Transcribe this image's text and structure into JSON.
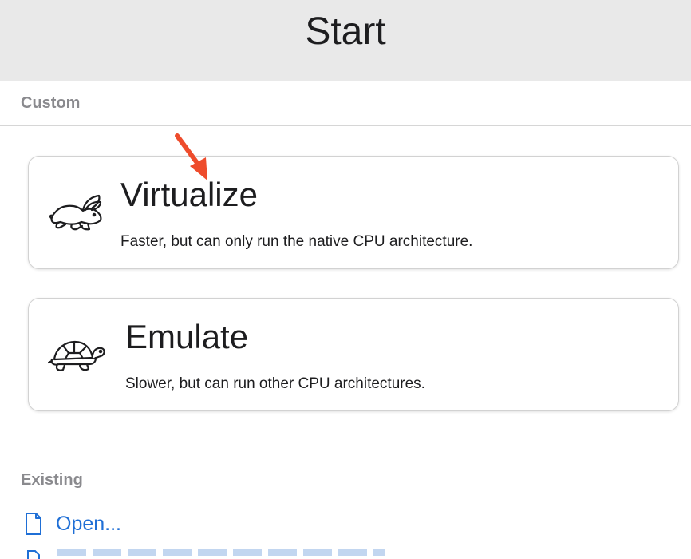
{
  "header": {
    "title": "Start"
  },
  "sections": {
    "custom_label": "Custom",
    "existing_label": "Existing"
  },
  "options": [
    {
      "title": "Virtualize",
      "description": "Faster, but can only run the native CPU architecture.",
      "icon": "rabbit-icon"
    },
    {
      "title": "Emulate",
      "description": "Slower, but can run other CPU architectures.",
      "icon": "turtle-icon"
    }
  ],
  "existing": {
    "open_label": "Open...",
    "open_icon": "document-icon"
  },
  "colors": {
    "header_bg": "#e9e9e9",
    "link": "#1f6fd6",
    "annotation_arrow": "#ee4c2c",
    "section_label": "#8a8a8e"
  }
}
